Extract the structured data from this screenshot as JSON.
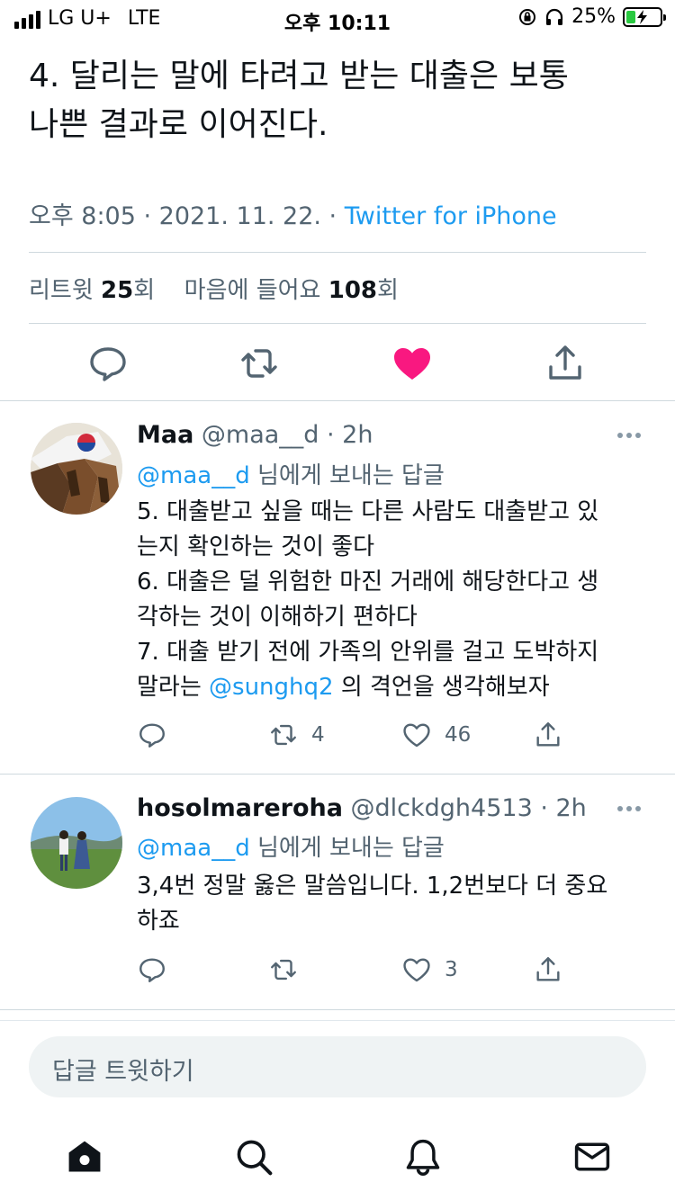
{
  "status_bar": {
    "carrier": "LG U+",
    "network": "LTE",
    "time": "오후 10:11",
    "battery": "25%"
  },
  "tweet": {
    "text_lines": [
      "4. 달리는 말에 타려고 받는 대출은 보통",
      "나쁜 결과로 이어진다."
    ],
    "time": "오후 8:05 · 2021. 11. 22. · ",
    "source": "Twitter for iPhone",
    "retweets_label": "리트윗 ",
    "retweets_count": "25",
    "retweets_unit": "회",
    "likes_label": "마음에 들어요 ",
    "likes_count": "108",
    "likes_unit": "회",
    "liked": true
  },
  "replies": [
    {
      "name": "Maa",
      "handle": "@maa__d · 2h",
      "replying_to": "@maa__d",
      "replying_suffix": " 님에게 보내는 답글",
      "lines": [
        "5. 대출받고 싶을 때는 다른 사람도 대출받고 있",
        "는지 확인하는 것이 좋다",
        "6. 대출은 덜 위험한 마진 거래에 해당한다고 생",
        "각하는 것이 이해하기 편하다",
        "7. 대출 받기 전에 가족의 안위를 걸고 도박하지"
      ],
      "last_line_prefix": "말라는 ",
      "last_line_mention": "@sunghq2",
      "last_line_suffix": " 의 격언을 생각해보자",
      "retweets": "4",
      "likes": "46"
    },
    {
      "name": "hosolmareroha",
      "handle": "@dlckdgh4513 · 2h",
      "replying_to": "@maa__d",
      "replying_suffix": " 님에게 보내는 답글",
      "lines": [
        "3,4번 정말 옳은 말씀입니다. 1,2번보다 더 중요",
        "하죠"
      ],
      "retweets": "",
      "likes": "3"
    }
  ],
  "compose": {
    "placeholder": "답글 트윗하기"
  },
  "tabbar": [
    "home-icon",
    "search-icon",
    "notifications-icon",
    "messages-icon"
  ],
  "colors": {
    "accent": "#1d9bf0",
    "like": "#f91880",
    "muted": "#536471"
  }
}
